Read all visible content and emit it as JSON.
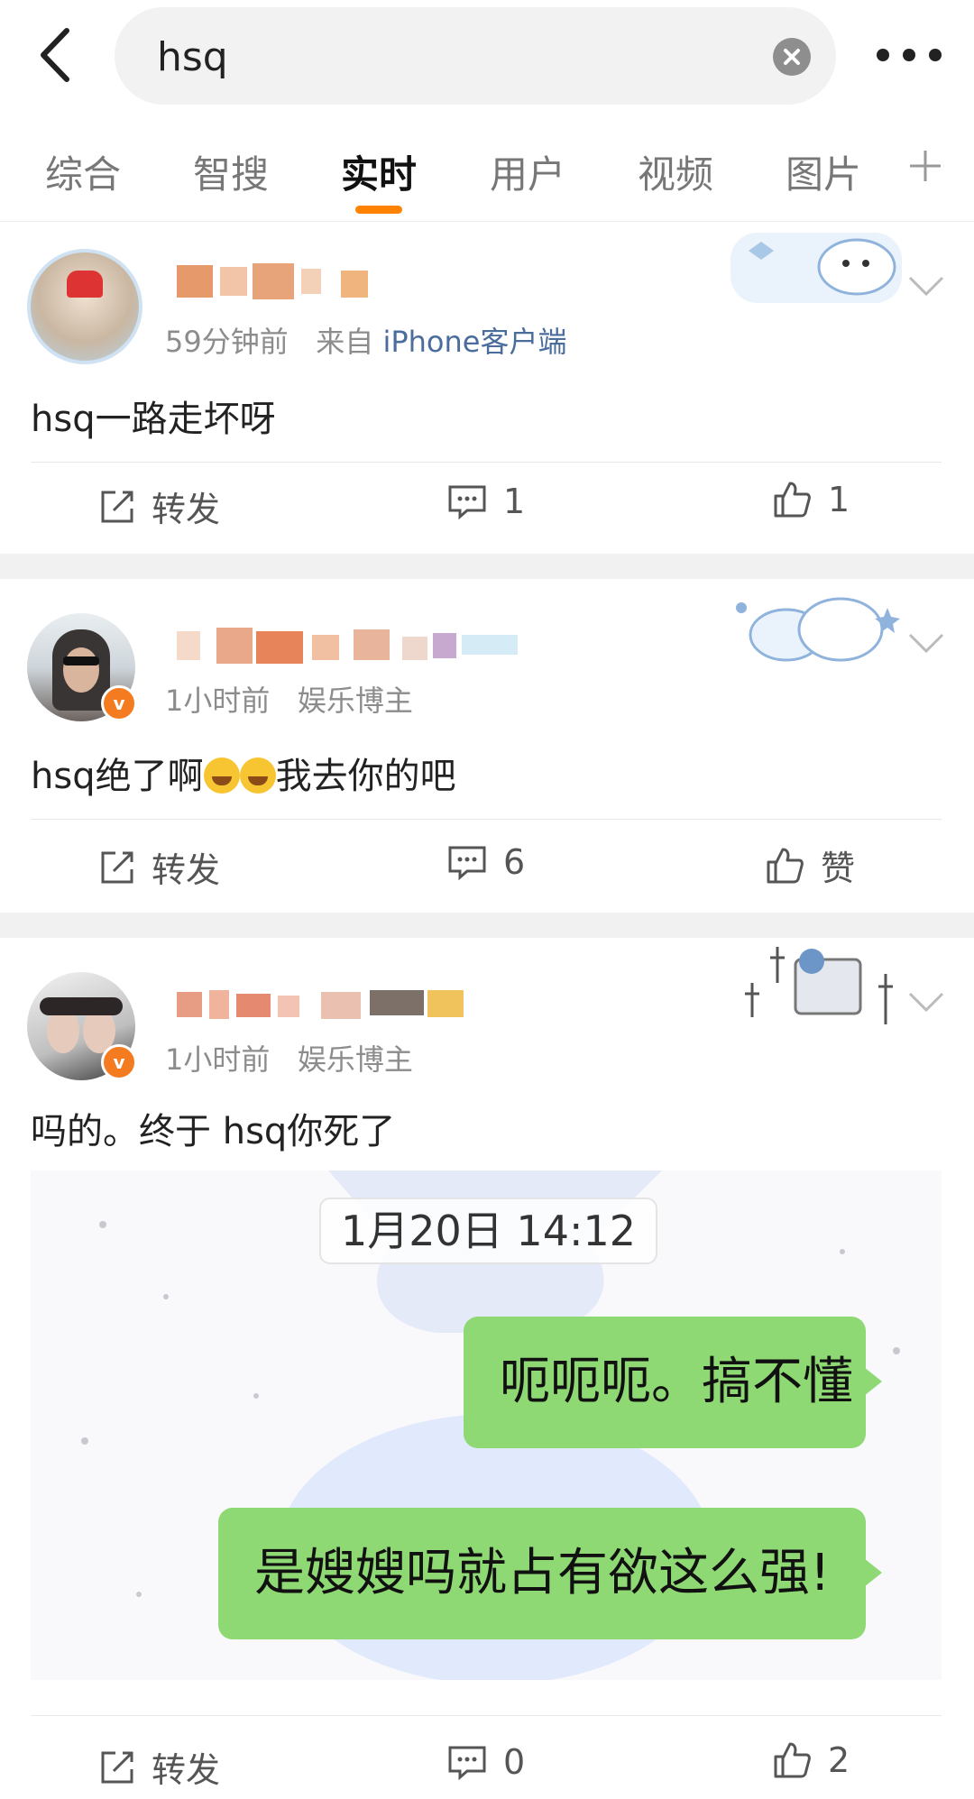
{
  "search": {
    "query": "hsq"
  },
  "tabs": [
    {
      "label": "综合"
    },
    {
      "label": "智搜"
    },
    {
      "label": "实时"
    },
    {
      "label": "用户"
    },
    {
      "label": "视频"
    },
    {
      "label": "图片"
    }
  ],
  "posts": [
    {
      "time": "59分钟前",
      "source_prefix": "来自",
      "source": "iPhone客户端",
      "text": "hsq一路走坏呀",
      "repost": "转发",
      "comments": "1",
      "likes": "1"
    },
    {
      "time": "1小时前",
      "tag": "娱乐博主",
      "text_a": "hsq绝了啊",
      "text_b": "我去你的吧",
      "repost": "转发",
      "comments": "6",
      "likes": "赞"
    },
    {
      "time": "1小时前",
      "tag": "娱乐博主",
      "text": "吗的。终于 hsq你死了",
      "image": {
        "timestamp": "1月20日 14:12",
        "bubble1": "呃呃呃。搞不懂",
        "bubble2": "是嫂嫂吗就占有欲这么强!"
      },
      "repost": "转发",
      "comments": "0",
      "likes": "2"
    }
  ],
  "colors": {
    "accent": "#ff8200",
    "link": "#4a6d9c",
    "bubble": "#8fd974"
  }
}
